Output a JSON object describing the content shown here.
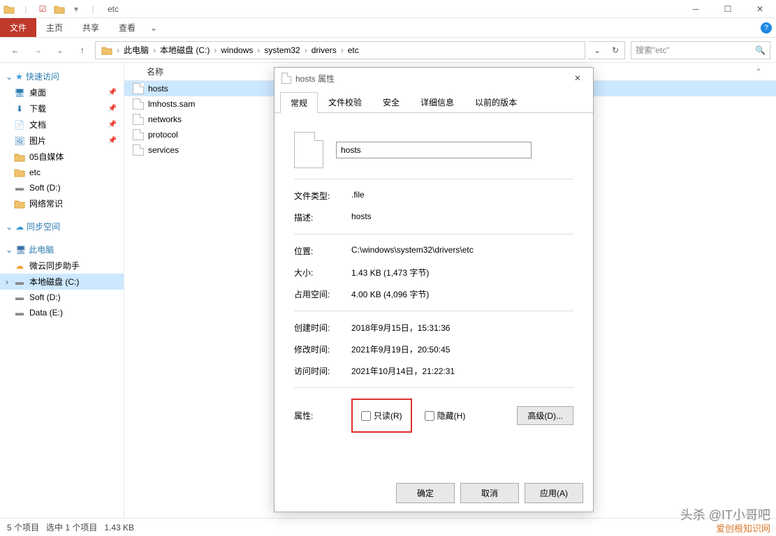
{
  "window": {
    "title": "etc"
  },
  "ribbon": {
    "file": "文件",
    "home": "主页",
    "share": "共享",
    "view": "查看"
  },
  "nav": {
    "crumbs": [
      "此电脑",
      "本地磁盘 (C:)",
      "windows",
      "system32",
      "drivers",
      "etc"
    ],
    "search_placeholder": "搜索\"etc\""
  },
  "sidebar": {
    "quick_access": "快速访问",
    "items_pinned": [
      {
        "label": "桌面",
        "icon": "desktop"
      },
      {
        "label": "下载",
        "icon": "downloads"
      },
      {
        "label": "文档",
        "icon": "documents"
      },
      {
        "label": "图片",
        "icon": "pictures"
      }
    ],
    "items_recent": [
      {
        "label": "05自媒体"
      },
      {
        "label": "etc"
      },
      {
        "label": "Soft (D:)"
      },
      {
        "label": "网络常识"
      }
    ],
    "sync": "同步空间",
    "this_pc": "此电脑",
    "pc_items": [
      {
        "label": "微云同步助手",
        "icon": "cloud"
      },
      {
        "label": "本地磁盘 (C:)",
        "icon": "drive",
        "selected": true
      },
      {
        "label": "Soft (D:)",
        "icon": "drive"
      },
      {
        "label": "Data (E:)",
        "icon": "drive"
      }
    ]
  },
  "list": {
    "header_name": "名称",
    "files": [
      "hosts",
      "lmhosts.sam",
      "networks",
      "protocol",
      "services"
    ]
  },
  "status": {
    "count": "5 个项目",
    "selected": "选中 1 个项目",
    "size": "1.43 KB"
  },
  "dialog": {
    "title": "hosts 属性",
    "tabs": [
      "常规",
      "文件校验",
      "安全",
      "详细信息",
      "以前的版本"
    ],
    "filename": "hosts",
    "rows": {
      "type_label": "文件类型:",
      "type_value": ".file",
      "desc_label": "描述:",
      "desc_value": "hosts",
      "loc_label": "位置:",
      "loc_value": "C:\\windows\\system32\\drivers\\etc",
      "size_label": "大小:",
      "size_value": "1.43 KB (1,473 字节)",
      "disk_label": "占用空间:",
      "disk_value": "4.00 KB (4,096 字节)",
      "created_label": "创建时间:",
      "created_value": "2018年9月15日，15:31:36",
      "modified_label": "修改时间:",
      "modified_value": "2021年9月19日，20:50:45",
      "accessed_label": "访问时间:",
      "accessed_value": "2021年10月14日，21:22:31",
      "attr_label": "属性:",
      "readonly": "只读(R)",
      "hidden": "隐藏(H)",
      "advanced": "高级(D)..."
    },
    "buttons": {
      "ok": "确定",
      "cancel": "取消",
      "apply": "应用(A)"
    }
  },
  "watermark": {
    "line1": "头杀 @IT小哥吧",
    "line2": "爱创根知识网"
  }
}
